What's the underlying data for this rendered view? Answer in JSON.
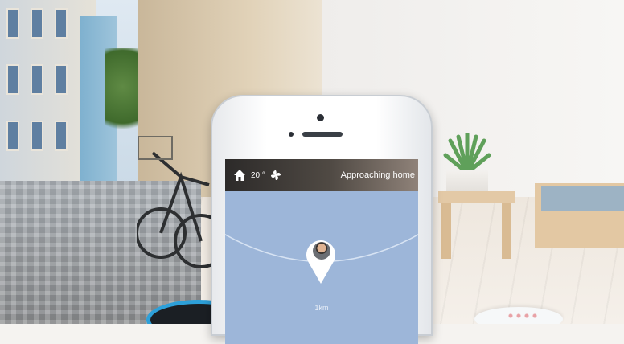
{
  "phone": {
    "status_bar": {
      "temperature": "20 °",
      "message": "Approaching home",
      "icons": [
        "home-icon",
        "fan-icon"
      ]
    },
    "map": {
      "distance": "1km",
      "icons": [
        "location-pin-icon",
        "avatar"
      ]
    }
  },
  "colors": {
    "screen": "#9db6d9",
    "status_bar": "#2c2a29",
    "speaker_ring": "#2da0d9"
  }
}
